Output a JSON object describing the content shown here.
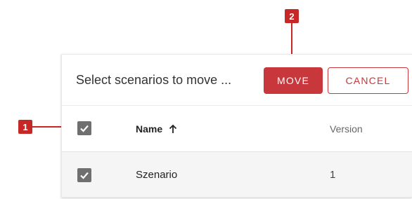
{
  "toolbar": {
    "title": "Select scenarios to move ...",
    "move_label": "MOVE",
    "cancel_label": "CANCEL"
  },
  "table": {
    "columns": [
      {
        "label": "Name",
        "sort": "ascending",
        "sort_icon": "arrow-up-icon"
      },
      {
        "label": "Version"
      }
    ],
    "select_all_checked": true,
    "rows": [
      {
        "checked": true,
        "name": "Szenario",
        "version": "1"
      }
    ]
  },
  "callouts": [
    {
      "label": "1",
      "target": "select-all-checkbox"
    },
    {
      "label": "2",
      "target": "move-button"
    }
  ],
  "colors": {
    "accent": "#c7373b",
    "callout": "#c62828",
    "checkbox": "#6f6f6f",
    "row_bg": "#f5f5f5"
  }
}
